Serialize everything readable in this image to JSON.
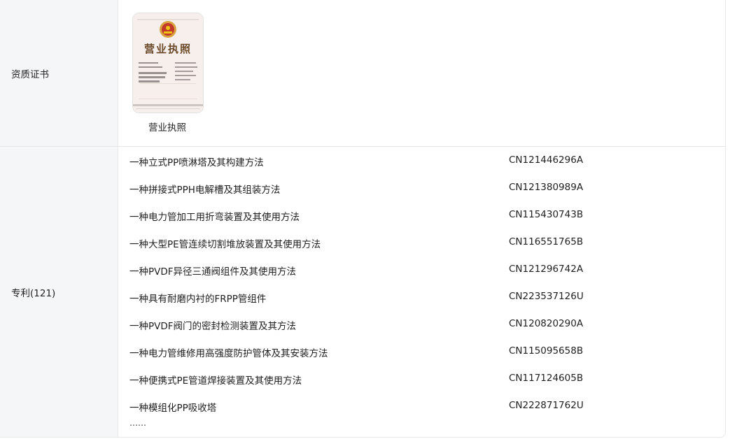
{
  "certificates": {
    "section_label": "资质证书",
    "items": [
      {
        "caption": "营业执照",
        "thumbnail_heading": "营业执照"
      }
    ]
  },
  "patents": {
    "section_label": "专利(121)",
    "items": [
      {
        "title": "一种立式PP喷淋塔及其构建方法",
        "number": "CN121446296A"
      },
      {
        "title": "一种拼接式PPH电解槽及其组装方法",
        "number": "CN121380989A"
      },
      {
        "title": "一种电力管加工用折弯装置及其使用方法",
        "number": "CN115430743B"
      },
      {
        "title": "一种大型PE管连续切割堆放装置及其使用方法",
        "number": "CN116551765B"
      },
      {
        "title": "一种PVDF异径三通阀组件及其使用方法",
        "number": "CN121296742A"
      },
      {
        "title": "一种具有耐磨内衬的FRPP管组件",
        "number": "CN223537126U"
      },
      {
        "title": "一种PVDF阀门的密封检测装置及其方法",
        "number": "CN120820290A"
      },
      {
        "title": "一种电力管维修用高强度防护管体及其安装方法",
        "number": "CN115095658B"
      },
      {
        "title": "一种便携式PE管道焊接装置及其使用方法",
        "number": "CN117124605B"
      },
      {
        "title": "一种模组化PP吸收塔",
        "number": "CN222871762U"
      }
    ],
    "more": "……"
  }
}
